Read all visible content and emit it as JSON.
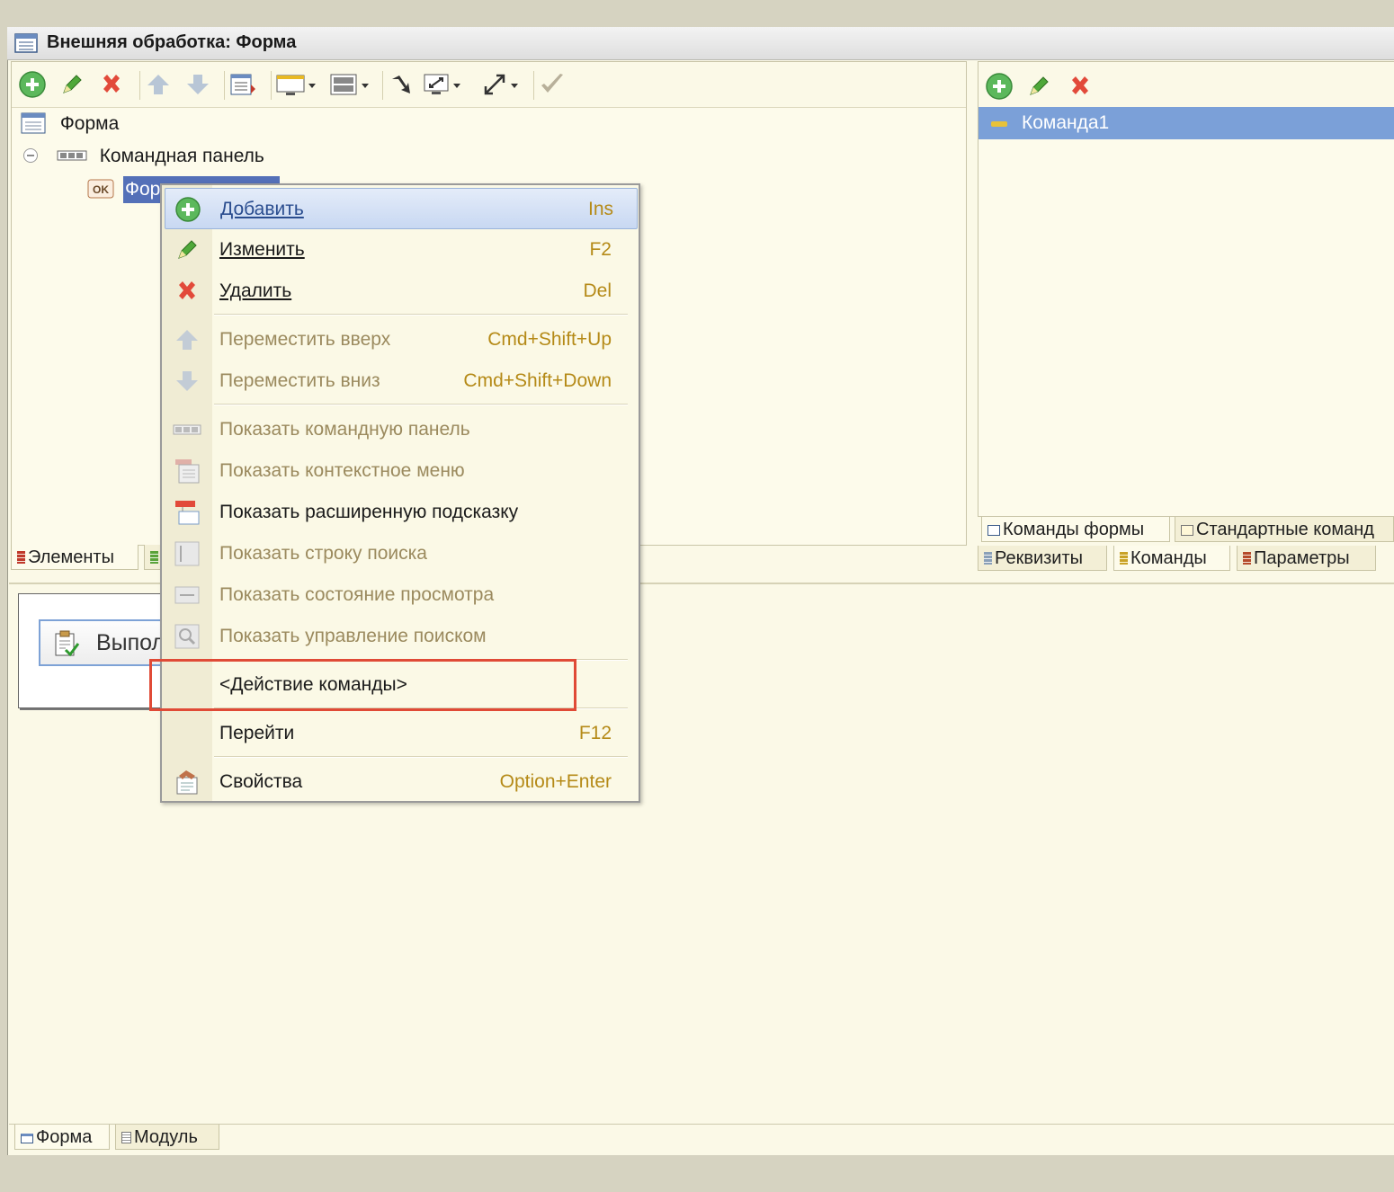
{
  "window": {
    "title": "Внешняя обработка: Форма"
  },
  "elements_tree": {
    "items": [
      {
        "label": "Форма",
        "icon": "form-icon"
      },
      {
        "label": "Командная панель",
        "icon": "command-panel-icon"
      },
      {
        "label": "Форма...",
        "icon": "ok-button-icon",
        "selected": true
      }
    ]
  },
  "left_tabs": [
    {
      "label": "Элементы"
    }
  ],
  "commands_panel": {
    "items": [
      {
        "label": "Команда1",
        "selected": true
      }
    ]
  },
  "right_tabs_top": [
    {
      "label": "Команды формы"
    },
    {
      "label": "Стандартные команд"
    }
  ],
  "right_tabs_bottom": [
    {
      "label": "Реквизиты"
    },
    {
      "label": "Команды"
    },
    {
      "label": "Параметры"
    }
  ],
  "preview": {
    "button_label": "Выпол"
  },
  "context_menu": {
    "items": [
      {
        "label": "Добавить",
        "shortcut": "Ins"
      },
      {
        "label": "Изменить",
        "shortcut": "F2"
      },
      {
        "label": "Удалить",
        "shortcut": "Del"
      },
      {
        "label": "Переместить вверх",
        "shortcut": "Cmd+Shift+Up"
      },
      {
        "label": "Переместить вниз",
        "shortcut": "Cmd+Shift+Down"
      },
      {
        "label": "Показать командную панель",
        "shortcut": ""
      },
      {
        "label": "Показать контекстное меню",
        "shortcut": ""
      },
      {
        "label": "Показать расширенную подсказку",
        "shortcut": ""
      },
      {
        "label": "Показать строку поиска",
        "shortcut": ""
      },
      {
        "label": "Показать состояние просмотра",
        "shortcut": ""
      },
      {
        "label": "Показать управление поиском",
        "shortcut": ""
      },
      {
        "label": "<Действие команды>",
        "shortcut": ""
      },
      {
        "label": "Перейти",
        "shortcut": "F12"
      },
      {
        "label": "Свойства",
        "shortcut": "Option+Enter"
      }
    ]
  },
  "bottom_tabs": [
    {
      "label": "Форма"
    },
    {
      "label": "Модуль"
    }
  ],
  "colors": {
    "highlight_box": "#e04a36",
    "selection": "#5470b8",
    "command_selection": "#7ba0d8"
  }
}
